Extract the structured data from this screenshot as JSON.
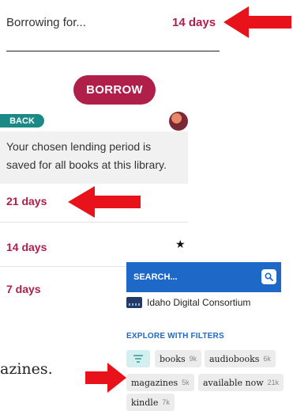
{
  "borrow_panel": {
    "borrowing_label": "Borrowing for...",
    "borrowing_value": "14 days",
    "borrow_button_label": "BORROW"
  },
  "lending_panel": {
    "back_label": "BACK",
    "info_text": "Your chosen lending period is saved for all books at this library.",
    "periods": [
      {
        "label": "21 days"
      },
      {
        "label": "14 days",
        "default": true
      },
      {
        "label": "7 days"
      }
    ],
    "default_icon": "star-icon"
  },
  "library_panel": {
    "search_placeholder": "SEARCH...",
    "library_name": "Idaho Digital Consortium",
    "explore_label": "EXPLORE WITH FILTERS",
    "filters": [
      {
        "label": "books",
        "count": "9k"
      },
      {
        "label": "audiobooks",
        "count": "6k"
      },
      {
        "label": "magazines",
        "count": "5k"
      },
      {
        "label": "available now",
        "count": "21k"
      },
      {
        "label": "kindle",
        "count": "7k"
      }
    ]
  },
  "partial_text": "azines.",
  "colors": {
    "accent_maroon": "#b01e4a",
    "teal": "#1b8a87",
    "search_blue": "#1e68c7",
    "arrow_red": "#e8131a"
  }
}
